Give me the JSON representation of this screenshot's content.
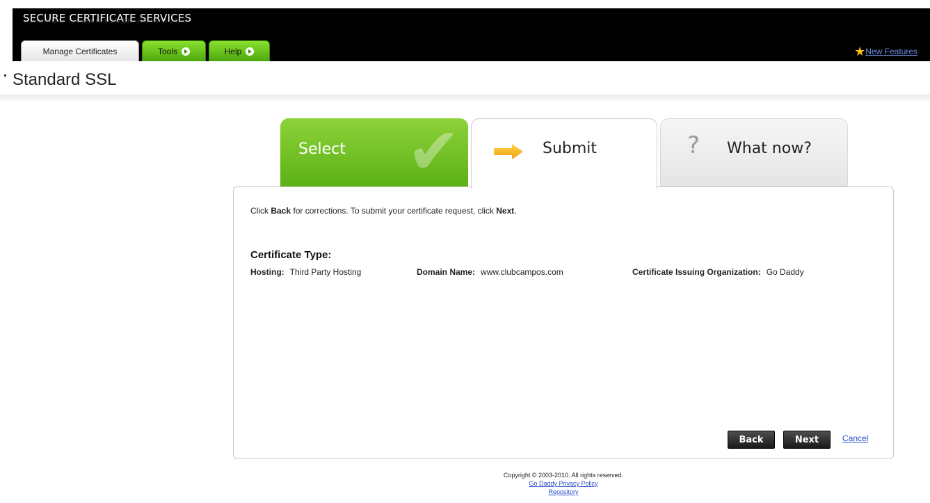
{
  "header": {
    "brand": "SECURE CERTIFICATE SERVICES",
    "tabs": [
      {
        "label": "Manage Certificates"
      },
      {
        "label": "Tools"
      },
      {
        "label": "Help"
      }
    ],
    "new_features": "New Features",
    "star_icon": "star-icon"
  },
  "page": {
    "title": "Standard SSL"
  },
  "wizard": {
    "steps": [
      {
        "label": "Select",
        "icon": "checkmark-icon",
        "state": "completed"
      },
      {
        "label": "Submit",
        "icon": "arrow-right-icon",
        "state": "active"
      },
      {
        "label": "What now?",
        "icon": "question-icon",
        "state": "pending"
      }
    ]
  },
  "panel": {
    "instruction_pre": "Click ",
    "instruction_back": "Back",
    "instruction_mid": " for corrections. To submit your certificate request, click ",
    "instruction_next": "Next",
    "instruction_end": ".",
    "cert_type_heading": "Certificate Type:",
    "fields": [
      {
        "label": "Hosting:",
        "value": "Third Party Hosting"
      },
      {
        "label": "Domain Name:",
        "value": "www.clubcampos.com"
      },
      {
        "label": "Certificate Issuing Organization:",
        "value": "Go Daddy"
      }
    ],
    "buttons": {
      "back": "Back",
      "next": "Next",
      "cancel": "Cancel"
    }
  },
  "footer": {
    "copyright": "Copyright © 2003-2010. All rights reserved.",
    "links": [
      "Go Daddy Privacy Policy",
      "Repository"
    ]
  },
  "colors": {
    "accent_green": "#5ab014",
    "header_black": "#000000",
    "link_blue": "#2b4fc9"
  }
}
